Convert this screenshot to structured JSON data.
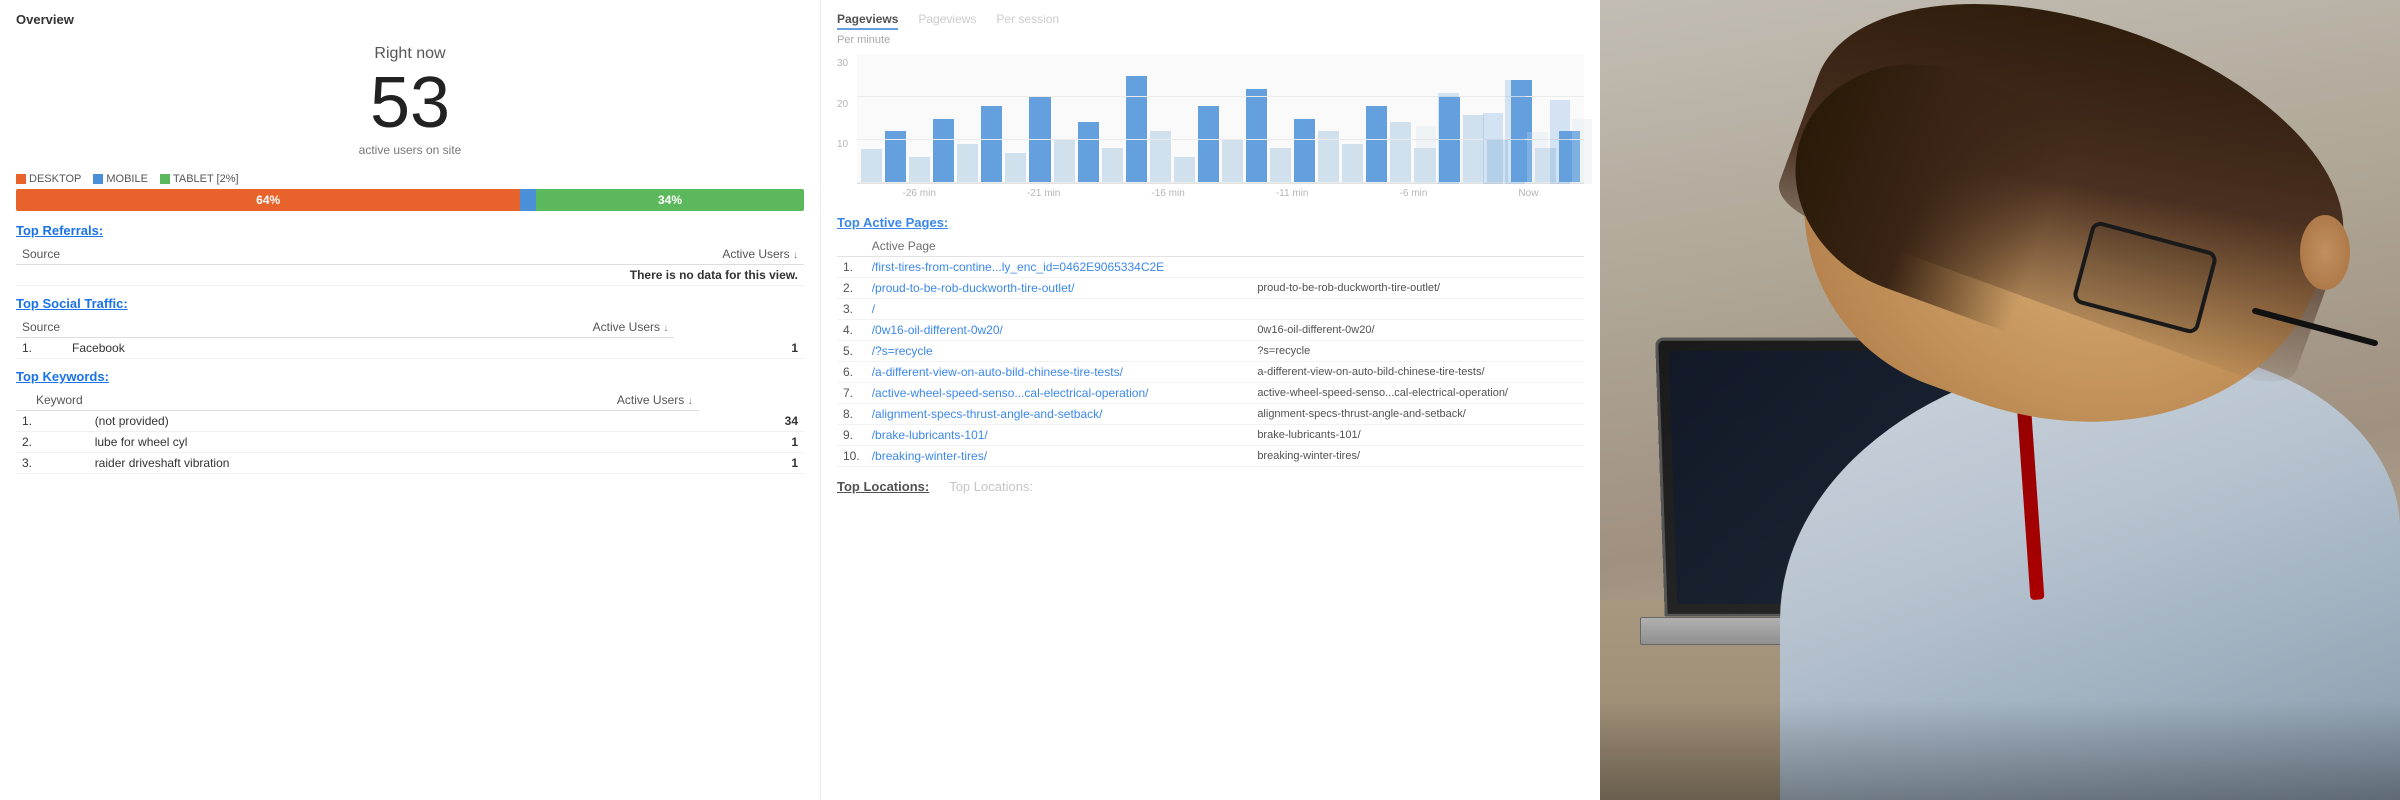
{
  "page": {
    "title": "Overview"
  },
  "realtime": {
    "right_now_label": "Right now",
    "active_users_count": "53",
    "active_users_label": "active users on site"
  },
  "device_breakdown": {
    "legend": [
      {
        "label": "DESKTOP",
        "color": "#e8622c"
      },
      {
        "label": "MOBILE",
        "color": "#4a90d9"
      },
      {
        "label": "TABLET [2%]",
        "color": "#5cb85c"
      }
    ],
    "bars": [
      {
        "label": "64%",
        "width": 64,
        "color": "#e8622c"
      },
      {
        "label": "34%",
        "width": 34,
        "color": "#5cb85c"
      }
    ]
  },
  "top_referrals": {
    "title": "Top Referrals:",
    "columns": [
      "Source",
      "Active Users"
    ],
    "no_data_message": "There is no data for this view."
  },
  "top_social": {
    "title": "Top Social Traffic:",
    "columns": [
      "Source",
      "Active Users"
    ],
    "rows": [
      {
        "num": "1.",
        "source": "Facebook",
        "users": "1"
      }
    ]
  },
  "top_keywords": {
    "title": "Top Keywords:",
    "columns": [
      "Keyword",
      "Active Users"
    ],
    "rows": [
      {
        "num": "1.",
        "keyword": "(not provided)",
        "users": "34"
      },
      {
        "num": "2.",
        "keyword": "lube for wheel cyl",
        "users": "1"
      },
      {
        "num": "3.",
        "keyword": "raider driveshaft vibration",
        "users": "1"
      }
    ]
  },
  "pageviews": {
    "title": "Pageviews",
    "tabs": [
      "Pageviews",
      "Pageviews",
      "Per session"
    ],
    "sublabels": [
      "Per minute",
      "Per minute",
      "Per session"
    ],
    "y_labels": [
      "30",
      "20",
      "10"
    ],
    "x_labels": [
      "-26 min",
      "-21 min",
      "-16 min",
      "-11 min",
      "-6 min",
      "Now"
    ],
    "bars": [
      8,
      12,
      6,
      15,
      9,
      18,
      7,
      20,
      10,
      14,
      8,
      25,
      12,
      6,
      18,
      10,
      22,
      8,
      15,
      12,
      9,
      18,
      14,
      8,
      20,
      16,
      10,
      24,
      8,
      12
    ]
  },
  "top_active_pages": {
    "title": "Top Active Pages:",
    "columns": [
      "Active Page"
    ],
    "rows": [
      {
        "num": "1.",
        "page": "/first-tires-from-contine...ly_enc_id=0462E9065334C2E",
        "ghost": ""
      },
      {
        "num": "2.",
        "page": "/proud-to-be-rob-duckworth-tire-outlet/",
        "ghost": "proud-to-be-rob-duckworth-tire-outlet/"
      },
      {
        "num": "3.",
        "page": "/",
        "ghost": ""
      },
      {
        "num": "4.",
        "page": "/0w16-oil-different-0w20/",
        "ghost": "0w16-oil-different-0w20/"
      },
      {
        "num": "5.",
        "page": "/?s=recycle",
        "ghost": "?s=recycle"
      },
      {
        "num": "6.",
        "page": "/a-different-view-on-auto-bild-chinese-tire-tests/",
        "ghost": "a-different-view-on-auto-bild-chinese-tire-tests/"
      },
      {
        "num": "7.",
        "page": "/active-wheel-speed-senso...cal-electrical-operation/",
        "ghost": "active-wheel-speed-senso...cal-electrical-operation/"
      },
      {
        "num": "8.",
        "page": "/alignment-specs-thrust-angle-and-setback/",
        "ghost": "alignment-specs-thrust-angle-and-setback/"
      },
      {
        "num": "9.",
        "page": "/brake-lubricants-101/",
        "ghost": "brake-lubricants-101/"
      },
      {
        "num": "10.",
        "page": "/breaking-winter-tires/",
        "ghost": "breaking-winter-tires/"
      }
    ]
  },
  "top_locations": {
    "title": "Top Locations:",
    "tabs": [
      "Top Locations:",
      "Top Locations:"
    ]
  }
}
